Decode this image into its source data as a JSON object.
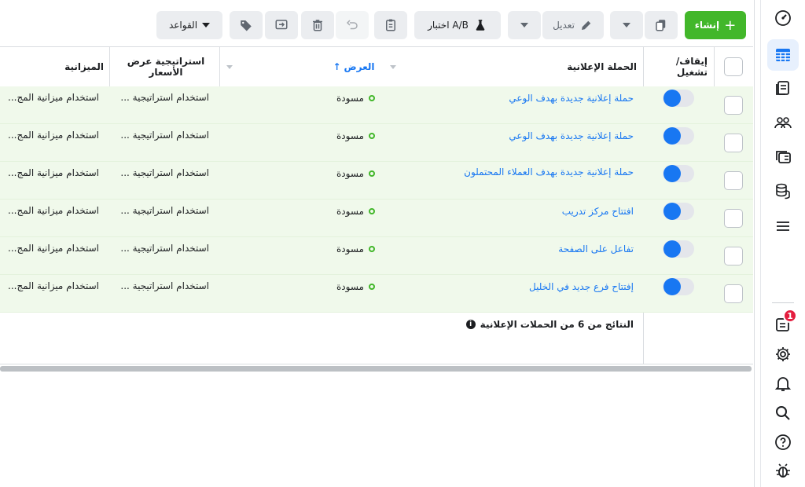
{
  "toolbar": {
    "create_label": "إنشاء",
    "edit_label": "تعديل",
    "ab_test_label": "اختبار A/B",
    "rules_label": "القواعد"
  },
  "table": {
    "headers": {
      "toggle": "إيقاف/ تشغيل",
      "campaign": "الحملة الإعلانية",
      "delivery": "العرض",
      "bid_strategy": "استراتيجية عرض الأسعار",
      "budget": "الميزانية"
    },
    "rows": [
      {
        "name": "حملة إعلانية جديدة بهدف الوعي",
        "delivery": "مسودة",
        "bid": "استخدام استراتيجية ...",
        "budget": "استخدام ميزانية المج..."
      },
      {
        "name": "حملة إعلانية جديدة بهدف الوعي",
        "delivery": "مسودة",
        "bid": "استخدام استراتيجية ...",
        "budget": "استخدام ميزانية المج..."
      },
      {
        "name": "حملة إعلانية جديدة بهدف العملاء المحتملون",
        "delivery": "مسودة",
        "bid": "استخدام استراتيجية ...",
        "budget": "استخدام ميزانية المج..."
      },
      {
        "name": "افتتاح مركز تدريب",
        "delivery": "مسودة",
        "bid": "استخدام استراتيجية ...",
        "budget": "استخدام ميزانية المج..."
      },
      {
        "name": "تفاعل على الصفحة",
        "delivery": "مسودة",
        "bid": "استخدام استراتيجية ...",
        "budget": "استخدام ميزانية المج..."
      },
      {
        "name": "إفتتاح فرع جديد في الخليل",
        "delivery": "مسودة",
        "bid": "استخدام استراتيجية ...",
        "budget": "استخدام ميزانية المج..."
      }
    ],
    "footer": "النتائج من 6 من الحملات الإعلانية"
  },
  "rail": {
    "notification_count": "1"
  },
  "colors": {
    "accent": "#1877f2",
    "create": "#42b72a",
    "row_bg": "#f0f9eb",
    "badge": "#e41e3f"
  }
}
